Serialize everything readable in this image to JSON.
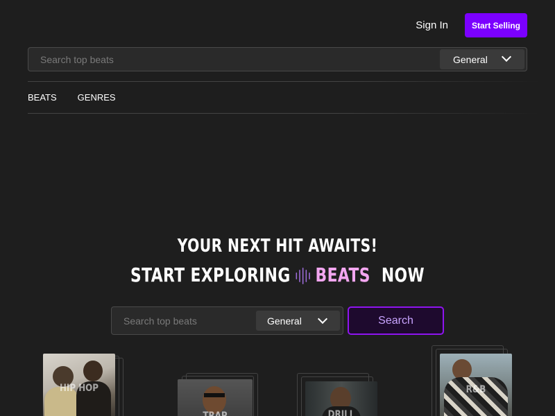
{
  "header": {
    "sign_in": "Sign In",
    "start_selling": "Start Selling"
  },
  "search_top": {
    "placeholder": "Search top beats",
    "category": "General"
  },
  "nav": {
    "items": [
      "BEATS",
      "GENRES"
    ]
  },
  "hero": {
    "line1": "YOUR NEXT HIT AWAITS!",
    "line2_prefix": "START EXPLORING",
    "line2_highlight": "BEATS",
    "line2_suffix": "NOW"
  },
  "search_main": {
    "placeholder": "Search top beats",
    "category": "General",
    "button": "Search"
  },
  "genres": [
    {
      "label": "HIP HOP"
    },
    {
      "label": "TRAP"
    },
    {
      "label": "DRILL"
    },
    {
      "label": "R&B"
    }
  ],
  "colors": {
    "accent": "#7b00ff",
    "highlight": "#f3a6f0",
    "background": "#1e1e1e"
  }
}
